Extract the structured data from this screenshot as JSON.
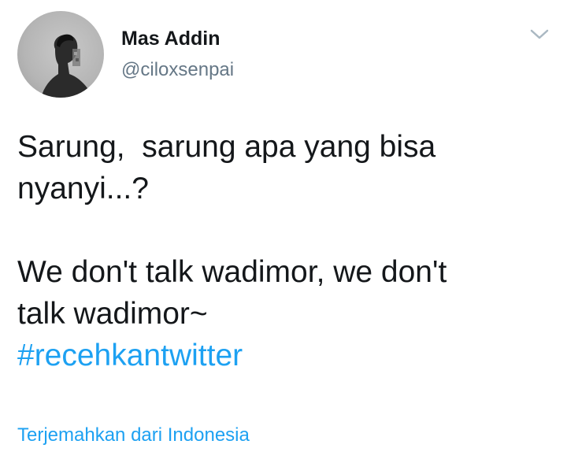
{
  "tweet": {
    "display_name": "Mas Addin",
    "handle": "@ciloxsenpai",
    "menu_icon": "chevron-down-icon",
    "text_lines_1": [
      "Sarung,  sarung apa yang bisa",
      "nyanyi...?"
    ],
    "text_lines_2": [
      "We don't talk wadimor, we don't",
      "talk wadimor~"
    ],
    "hashtag": "#recehkantwitter",
    "translate_label": "Terjemahkan dari Indonesia"
  },
  "colors": {
    "text": "#14171a",
    "secondary": "#657786",
    "link": "#1da1f2"
  }
}
